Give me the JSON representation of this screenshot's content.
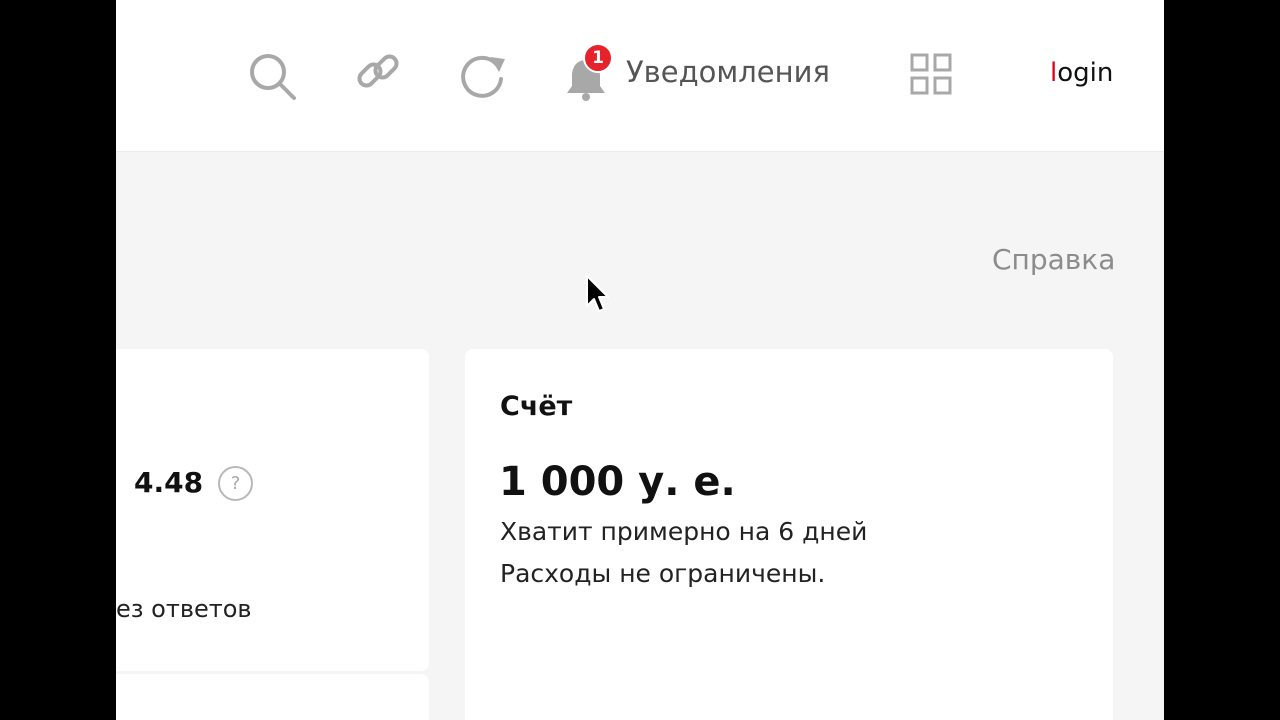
{
  "header": {
    "icons": [
      "search-icon",
      "link-icon",
      "refresh-icon",
      "bell-icon",
      "apps-grid-icon"
    ],
    "notifications": {
      "badge_count": "1",
      "label": "Уведомления"
    },
    "login": {
      "first_letter": "l",
      "rest": "ogin"
    }
  },
  "page": {
    "help_link": "Справка"
  },
  "rating_card": {
    "value": "4.48",
    "help_icon": "?",
    "no_answers_text": "ез ответов"
  },
  "account_card": {
    "title": "Счёт",
    "amount": "1 000 у. е.",
    "days_left": "Хватит примерно на 6 дней",
    "limit": "Расходы не ограничены."
  },
  "colors": {
    "badge": "#e6232b",
    "login_accent": "#e0001b",
    "icon_gray": "#a8a8a8"
  }
}
